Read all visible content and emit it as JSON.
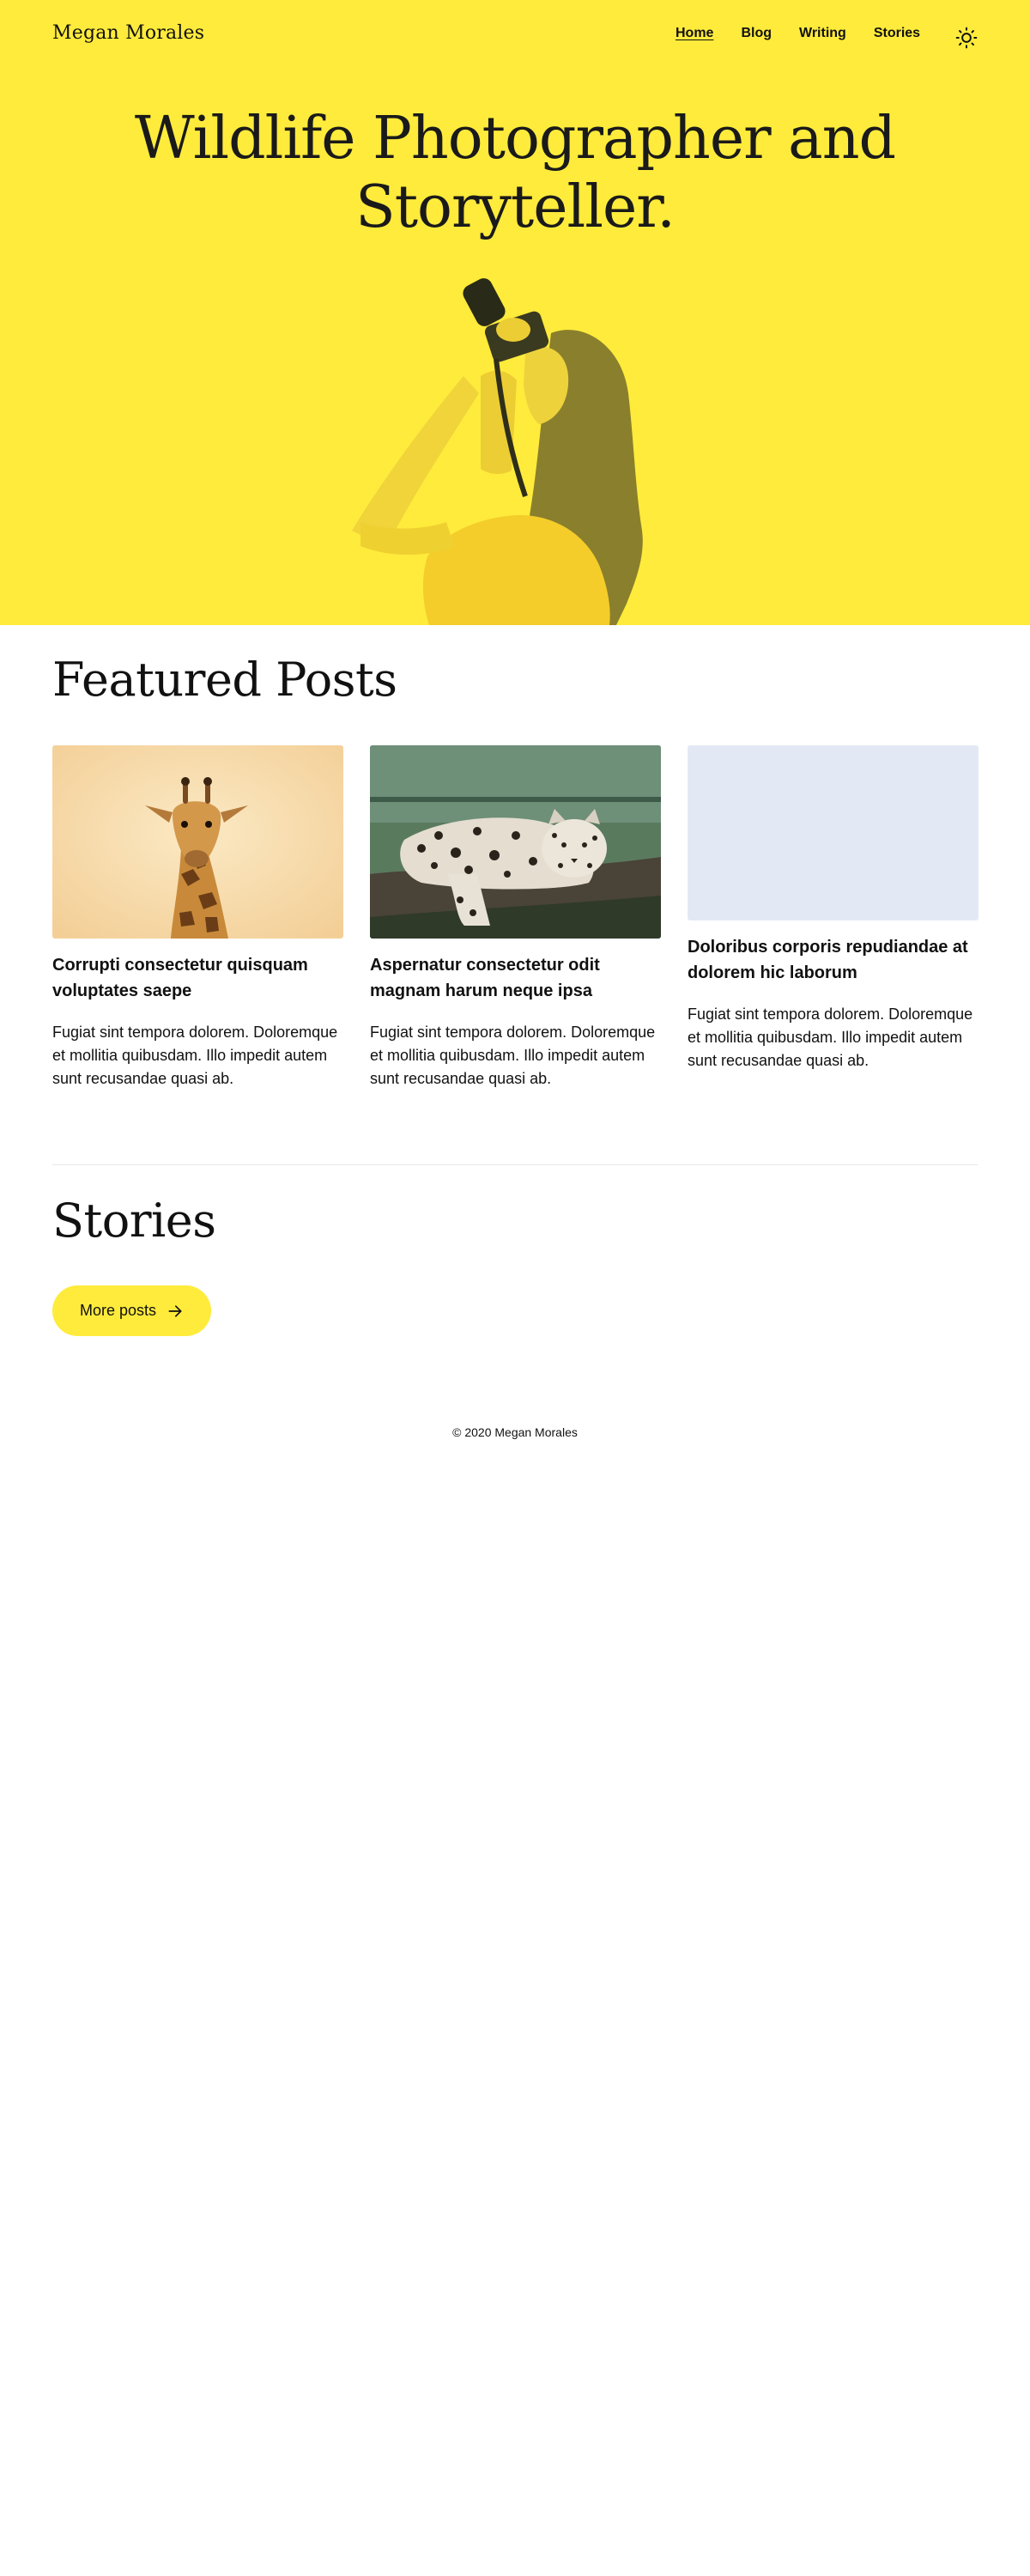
{
  "site": {
    "title": "Megan Morales"
  },
  "nav": {
    "items": [
      {
        "label": "Home",
        "active": true
      },
      {
        "label": "Blog",
        "active": false
      },
      {
        "label": "Writing",
        "active": false
      },
      {
        "label": "Stories",
        "active": false
      }
    ],
    "theme_toggle_icon": "sun-icon"
  },
  "hero": {
    "heading_line1": "Wildlife Photographer and",
    "heading_line2": "Storyteller.",
    "background_color": "#ffeb3b"
  },
  "featured": {
    "heading": "Featured Posts",
    "posts": [
      {
        "title": "Corrupti consectetur quisquam voluptates saepe",
        "excerpt": "Fugiat sint tempora dolorem. Doloremque et mollitia quibusdam. Illo impedit autem sunt recusandae quasi ab.",
        "image_icon": "giraffe-image"
      },
      {
        "title": "Aspernatur consectetur odit magnam harum neque ipsa",
        "excerpt": "Fugiat sint tempora dolorem. Doloremque et mollitia quibusdam. Illo impedit autem sunt recusandae quasi ab.",
        "image_icon": "leopard-image"
      },
      {
        "title": "Doloribus corporis repudiandae at dolorem hic laborum",
        "excerpt": "Fugiat sint tempora dolorem. Doloremque et mollitia quibusdam. Illo impedit autem sunt recusandae quasi ab.",
        "image_icon": "placeholder-image"
      }
    ]
  },
  "stories": {
    "heading": "Stories",
    "more_button_label": "More posts",
    "more_button_icon": "arrow-right-icon"
  },
  "footer": {
    "copyright": "© 2020 Megan Morales"
  }
}
